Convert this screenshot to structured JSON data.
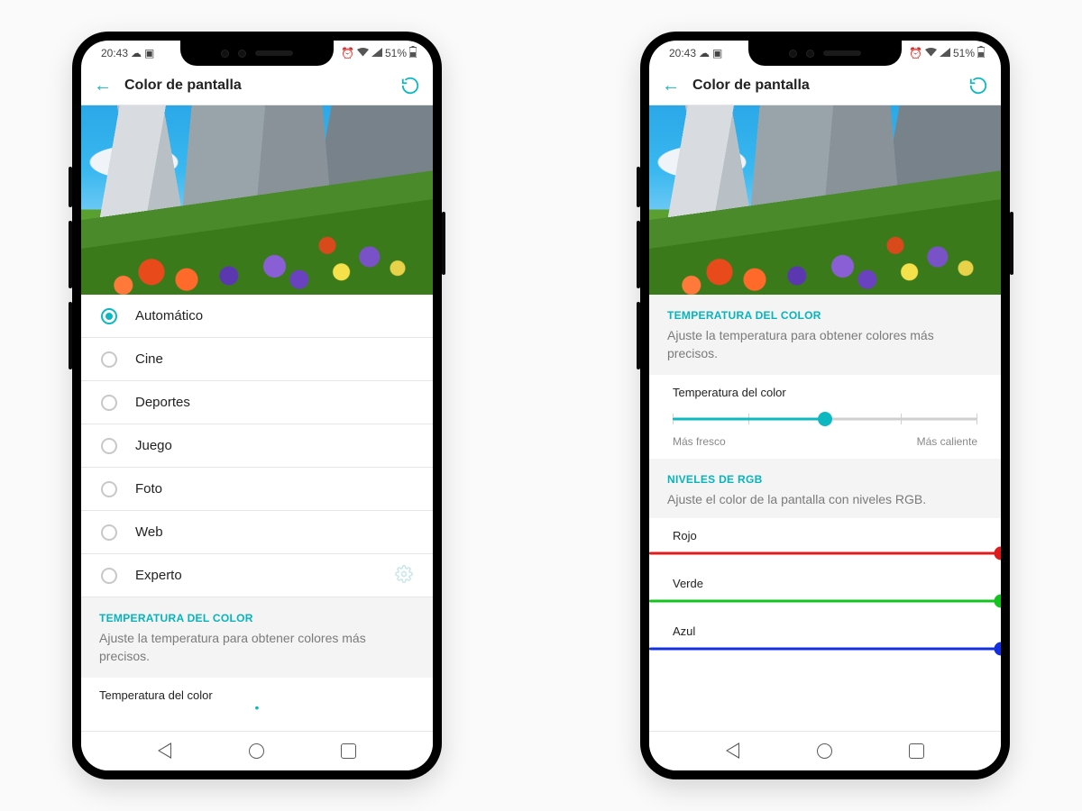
{
  "status": {
    "time": "20:43",
    "battery": "51%"
  },
  "appbar": {
    "title": "Color de pantalla"
  },
  "modes": [
    {
      "label": "Automático",
      "selected": true
    },
    {
      "label": "Cine",
      "selected": false
    },
    {
      "label": "Deportes",
      "selected": false
    },
    {
      "label": "Juego",
      "selected": false
    },
    {
      "label": "Foto",
      "selected": false
    },
    {
      "label": "Web",
      "selected": false
    },
    {
      "label": "Experto",
      "selected": false,
      "gear": true
    }
  ],
  "temp": {
    "title": "TEMPERATURA DEL COLOR",
    "desc": "Ajuste la temperatura para obtener colores más precisos.",
    "slider_label": "Temperatura del color",
    "left": "Más fresco",
    "right": "Más caliente",
    "value_pct": 50
  },
  "rgb": {
    "title": "NIVELES DE RGB",
    "desc": "Ajuste el color de la pantalla con niveles RGB.",
    "channels": [
      {
        "label": "Rojo",
        "color": "#e11b1b"
      },
      {
        "label": "Verde",
        "color": "#13c41f"
      },
      {
        "label": "Azul",
        "color": "#1330e0"
      }
    ]
  }
}
